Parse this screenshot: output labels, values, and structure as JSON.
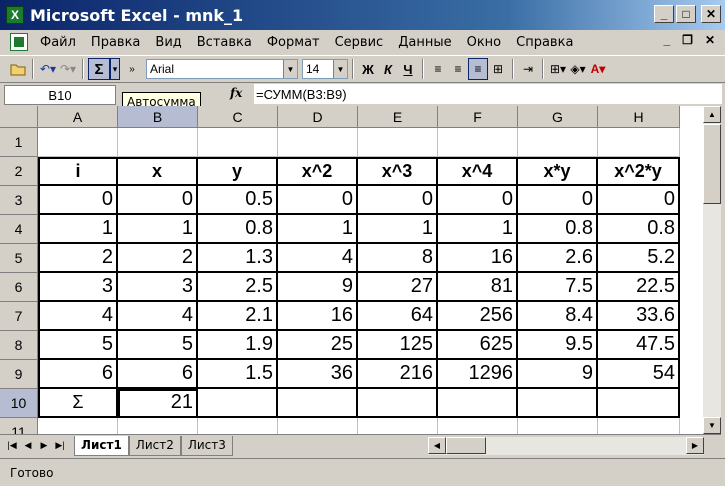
{
  "window": {
    "title": "Microsoft Excel - mnk_1"
  },
  "menu": {
    "items": [
      "Файл",
      "Правка",
      "Вид",
      "Вставка",
      "Формат",
      "Сервис",
      "Данные",
      "Окно",
      "Справка"
    ]
  },
  "toolbar": {
    "font_name": "Arial",
    "font_size": "14",
    "autosum_symbol": "Σ",
    "bold": "Ж",
    "italic": "К",
    "underline": "Ч"
  },
  "formula_bar": {
    "name_box": "B10",
    "fx": "fx",
    "formula": "=СУММ(B3:B9)"
  },
  "tooltip": {
    "text": "Автосумма"
  },
  "sheet": {
    "columns": [
      "A",
      "B",
      "C",
      "D",
      "E",
      "F",
      "G",
      "H"
    ],
    "selected_column": "B",
    "selected_row": "10",
    "active_cell": "B10",
    "rows": [
      {
        "num": "1",
        "cells": [
          "",
          "",
          "",
          "",
          "",
          "",
          "",
          ""
        ]
      },
      {
        "num": "2",
        "cells": [
          "i",
          "x",
          "y",
          "x^2",
          "x^3",
          "x^4",
          "x*y",
          "x^2*y"
        ]
      },
      {
        "num": "3",
        "cells": [
          "0",
          "0",
          "0.5",
          "0",
          "0",
          "0",
          "0",
          "0"
        ]
      },
      {
        "num": "4",
        "cells": [
          "1",
          "1",
          "0.8",
          "1",
          "1",
          "1",
          "0.8",
          "0.8"
        ]
      },
      {
        "num": "5",
        "cells": [
          "2",
          "2",
          "1.3",
          "4",
          "8",
          "16",
          "2.6",
          "5.2"
        ]
      },
      {
        "num": "6",
        "cells": [
          "3",
          "3",
          "2.5",
          "9",
          "27",
          "81",
          "7.5",
          "22.5"
        ]
      },
      {
        "num": "7",
        "cells": [
          "4",
          "4",
          "2.1",
          "16",
          "64",
          "256",
          "8.4",
          "33.6"
        ]
      },
      {
        "num": "8",
        "cells": [
          "5",
          "5",
          "1.9",
          "25",
          "125",
          "625",
          "9.5",
          "47.5"
        ]
      },
      {
        "num": "9",
        "cells": [
          "6",
          "6",
          "1.5",
          "36",
          "216",
          "1296",
          "9",
          "54"
        ]
      },
      {
        "num": "10",
        "cells": [
          "Σ",
          "21",
          "",
          "",
          "",
          "",
          "",
          ""
        ]
      },
      {
        "num": "11",
        "cells": [
          "",
          "",
          "",
          "",
          "",
          "",
          "",
          ""
        ]
      }
    ]
  },
  "sheet_tabs": [
    "Лист1",
    "Лист2",
    "Лист3"
  ],
  "active_tab": "Лист1",
  "status": {
    "text": "Готово"
  }
}
